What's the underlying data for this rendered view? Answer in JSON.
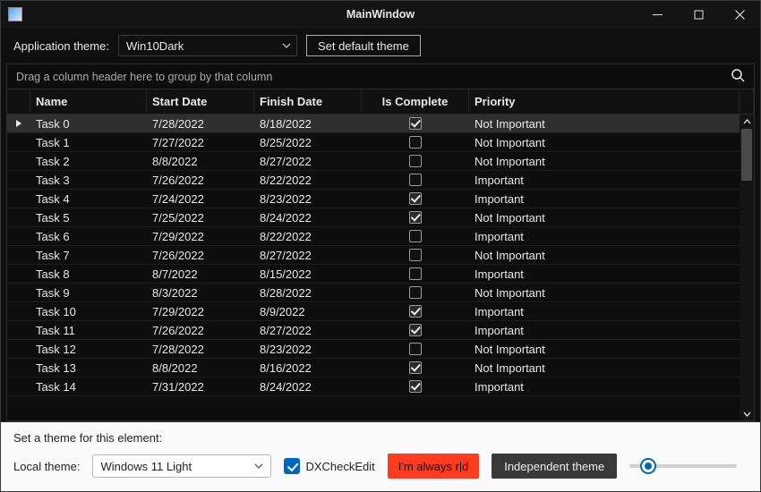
{
  "window": {
    "title": "MainWindow"
  },
  "theme_strip": {
    "label": "Application theme:",
    "combo_value": "Win10Dark",
    "default_btn": "Set default theme"
  },
  "grid": {
    "group_hint": "Drag a column header here to group by that column",
    "columns": {
      "name": "Name",
      "start": "Start Date",
      "finish": "Finish Date",
      "complete": "Is Complete",
      "priority": "Priority"
    },
    "rows": [
      {
        "name": "Task 0",
        "start": "7/28/2022",
        "finish": "8/18/2022",
        "complete": true,
        "priority": "Not Important",
        "selected": true
      },
      {
        "name": "Task 1",
        "start": "7/27/2022",
        "finish": "8/25/2022",
        "complete": false,
        "priority": "Not Important"
      },
      {
        "name": "Task 2",
        "start": "8/8/2022",
        "finish": "8/27/2022",
        "complete": false,
        "priority": "Not Important"
      },
      {
        "name": "Task 3",
        "start": "7/26/2022",
        "finish": "8/22/2022",
        "complete": false,
        "priority": "Important"
      },
      {
        "name": "Task 4",
        "start": "7/24/2022",
        "finish": "8/23/2022",
        "complete": true,
        "priority": "Important"
      },
      {
        "name": "Task 5",
        "start": "7/25/2022",
        "finish": "8/24/2022",
        "complete": true,
        "priority": "Not Important"
      },
      {
        "name": "Task 6",
        "start": "7/29/2022",
        "finish": "8/22/2022",
        "complete": false,
        "priority": "Important"
      },
      {
        "name": "Task 7",
        "start": "7/26/2022",
        "finish": "8/27/2022",
        "complete": false,
        "priority": "Not Important"
      },
      {
        "name": "Task 8",
        "start": "8/7/2022",
        "finish": "8/15/2022",
        "complete": false,
        "priority": "Important"
      },
      {
        "name": "Task 9",
        "start": "8/3/2022",
        "finish": "8/28/2022",
        "complete": false,
        "priority": "Not Important"
      },
      {
        "name": "Task 10",
        "start": "7/29/2022",
        "finish": "8/9/2022",
        "complete": true,
        "priority": "Important"
      },
      {
        "name": "Task 11",
        "start": "7/26/2022",
        "finish": "8/27/2022",
        "complete": true,
        "priority": "Important"
      },
      {
        "name": "Task 12",
        "start": "7/28/2022",
        "finish": "8/23/2022",
        "complete": false,
        "priority": "Not Important"
      },
      {
        "name": "Task 13",
        "start": "8/8/2022",
        "finish": "8/16/2022",
        "complete": true,
        "priority": "Not Important"
      },
      {
        "name": "Task 14",
        "start": "7/31/2022",
        "finish": "8/24/2022",
        "complete": true,
        "priority": "Important"
      }
    ]
  },
  "bottom": {
    "heading": "Set a theme for this element:",
    "local_label": "Local theme:",
    "local_combo": "Windows 11 Light",
    "check_label": "DXCheckEdit",
    "red_btn_a": "I'm always r",
    "red_btn_b": "d",
    "dark_btn": "Independent theme"
  }
}
